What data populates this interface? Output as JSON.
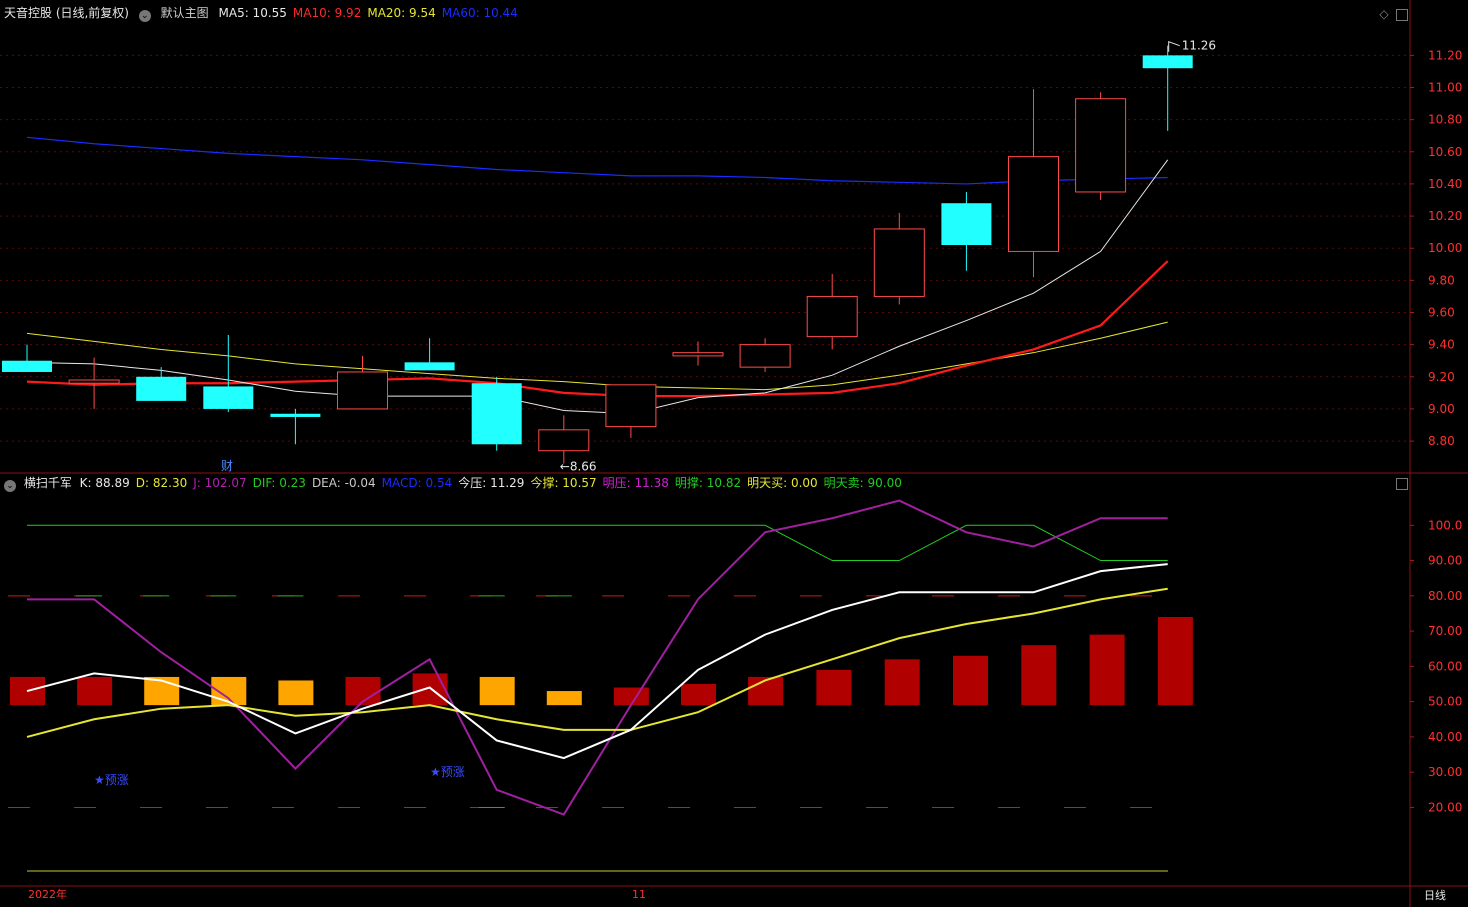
{
  "header": {
    "stock_name": "天音控股 (日线,前复权)",
    "main_chart_label": "默认主图",
    "ma": [
      {
        "label": "MA5: ",
        "value": "10.55",
        "color": "#e8e8e8"
      },
      {
        "label": "MA10: ",
        "value": "9.92",
        "color": "#ff2a2a"
      },
      {
        "label": "MA20: ",
        "value": "9.54",
        "color": "#e6e632"
      },
      {
        "label": "MA60: ",
        "value": "10.44",
        "color": "#1a2cff"
      }
    ]
  },
  "indicator_header": {
    "name": "横扫千军",
    "items": [
      {
        "text": "K: 88.89",
        "color": "#e8e8e8"
      },
      {
        "text": "D: 82.30",
        "color": "#e6e632"
      },
      {
        "text": "J: 102.07",
        "color": "#b020b0"
      },
      {
        "text": "DIF: 0.23",
        "color": "#22cc22"
      },
      {
        "text": "DEA: -0.04",
        "color": "#c8c8c8"
      },
      {
        "text": "MACD: 0.54",
        "color": "#1a2cff"
      },
      {
        "text": "今压: 11.29",
        "color": "#e8e8e8"
      },
      {
        "text": "今撑: 10.57",
        "color": "#e6e632"
      },
      {
        "text": "明压: 11.38",
        "color": "#d020d0"
      },
      {
        "text": "明撑: 10.82",
        "color": "#22cc22"
      },
      {
        "text": "明天买: 0.00",
        "color": "#e6e632"
      },
      {
        "text": "明天卖: 90.00",
        "color": "#22cc22"
      }
    ]
  },
  "bottom_bar": {
    "year_label": "2022年",
    "month_label": "11",
    "period_label": "日线"
  },
  "markers": {
    "finance": "财",
    "forecast": "★预涨"
  },
  "chart_data": [
    {
      "type": "candlestick",
      "ylim": [
        8.62,
        11.42
      ],
      "y_ticks": [
        "8.80",
        "9.00",
        "9.20",
        "9.40",
        "9.60",
        "9.80",
        "10.00",
        "10.20",
        "10.40",
        "10.60",
        "10.80",
        "11.00",
        "11.20"
      ],
      "y_tick_values": [
        8.8,
        9.0,
        9.2,
        9.4,
        9.6,
        9.8,
        10.0,
        10.2,
        10.4,
        10.6,
        10.8,
        11.0,
        11.2
      ],
      "candles": [
        {
          "o": 9.3,
          "h": 9.4,
          "l": 9.23,
          "c": 9.23
        },
        {
          "o": 9.16,
          "h": 9.32,
          "l": 9.0,
          "c": 9.18
        },
        {
          "o": 9.2,
          "h": 9.26,
          "l": 9.05,
          "c": 9.05
        },
        {
          "o": 9.14,
          "h": 9.46,
          "l": 8.98,
          "c": 9.0
        },
        {
          "o": 8.97,
          "h": 9.0,
          "l": 8.78,
          "c": 8.95
        },
        {
          "o": 9.0,
          "h": 9.33,
          "l": 9.0,
          "c": 9.23
        },
        {
          "o": 9.29,
          "h": 9.44,
          "l": 9.24,
          "c": 9.24
        },
        {
          "o": 9.16,
          "h": 9.2,
          "l": 8.74,
          "c": 8.78
        },
        {
          "o": 8.74,
          "h": 8.96,
          "l": 8.66,
          "c": 8.87
        },
        {
          "o": 8.89,
          "h": 9.15,
          "l": 8.82,
          "c": 9.15
        },
        {
          "o": 9.33,
          "h": 9.42,
          "l": 9.27,
          "c": 9.35
        },
        {
          "o": 9.26,
          "h": 9.44,
          "l": 9.23,
          "c": 9.4
        },
        {
          "o": 9.45,
          "h": 9.84,
          "l": 9.37,
          "c": 9.7
        },
        {
          "o": 9.7,
          "h": 10.22,
          "l": 9.65,
          "c": 10.12
        },
        {
          "o": 10.28,
          "h": 10.35,
          "l": 9.86,
          "c": 10.02
        },
        {
          "o": 9.98,
          "h": 10.99,
          "l": 9.82,
          "c": 10.57
        },
        {
          "o": 10.35,
          "h": 10.97,
          "l": 10.3,
          "c": 10.93
        },
        {
          "o": 11.2,
          "h": 11.26,
          "l": 10.73,
          "c": 11.12
        }
      ],
      "ma5": [
        9.29,
        9.28,
        9.24,
        9.18,
        9.11,
        9.08,
        9.08,
        9.08,
        8.99,
        8.97,
        9.07,
        9.1,
        9.21,
        9.39,
        9.55,
        9.72,
        9.98,
        10.55
      ],
      "ma10": [
        9.17,
        9.15,
        9.16,
        9.16,
        9.17,
        9.18,
        9.19,
        9.16,
        9.1,
        9.08,
        9.08,
        9.09,
        9.1,
        9.16,
        9.27,
        9.37,
        9.52,
        9.92
      ],
      "ma20": [
        9.47,
        9.42,
        9.37,
        9.33,
        9.28,
        9.25,
        9.22,
        9.19,
        9.17,
        9.14,
        9.13,
        9.12,
        9.15,
        9.21,
        9.28,
        9.35,
        9.44,
        9.54
      ],
      "ma60": [
        10.69,
        10.65,
        10.62,
        10.59,
        10.57,
        10.55,
        10.52,
        10.49,
        10.47,
        10.45,
        10.45,
        10.44,
        10.42,
        10.41,
        10.4,
        10.42,
        10.43,
        10.44
      ],
      "annotations": {
        "low": "←8.66",
        "high": "11.26"
      }
    },
    {
      "type": "line",
      "name": "横扫千军",
      "ylim": [
        0,
        110
      ],
      "y_ticks": [
        "20.00",
        "30.00",
        "40.00",
        "50.00",
        "60.00",
        "70.00",
        "80.00",
        "90.00",
        "100.0"
      ],
      "y_tick_values": [
        20,
        30,
        40,
        50,
        60,
        70,
        80,
        90,
        100
      ],
      "k": [
        53,
        58,
        56,
        50,
        41,
        48,
        54,
        39,
        34,
        42,
        59,
        69,
        76,
        81,
        81,
        81,
        87,
        89
      ],
      "d": [
        40,
        45,
        48,
        49,
        46,
        47,
        49,
        45,
        42,
        42,
        47,
        56,
        62,
        68,
        72,
        75,
        79,
        82
      ],
      "j": [
        79,
        79,
        64,
        51,
        31,
        50,
        62,
        25,
        18,
        49,
        79,
        98,
        102,
        107,
        98,
        94,
        102,
        102
      ],
      "bars": [
        {
          "v": 57,
          "c": "red"
        },
        {
          "v": 57,
          "c": "red"
        },
        {
          "v": 57,
          "c": "orange"
        },
        {
          "v": 57,
          "c": "orange"
        },
        {
          "v": 56,
          "c": "orange"
        },
        {
          "v": 57,
          "c": "red"
        },
        {
          "v": 58,
          "c": "red"
        },
        {
          "v": 57,
          "c": "orange"
        },
        {
          "v": 53,
          "c": "orange"
        },
        {
          "v": 54,
          "c": "red"
        },
        {
          "v": 55,
          "c": "red"
        },
        {
          "v": 57,
          "c": "red"
        },
        {
          "v": 59,
          "c": "red"
        },
        {
          "v": 62,
          "c": "red"
        },
        {
          "v": 63,
          "c": "red"
        },
        {
          "v": 66,
          "c": "red"
        },
        {
          "v": 69,
          "c": "red"
        },
        {
          "v": 74,
          "c": "red"
        }
      ],
      "bar_base": 49,
      "green_line": [
        100,
        100,
        100,
        100,
        100,
        100,
        100,
        100,
        100,
        100,
        100,
        100,
        90,
        90,
        100,
        100,
        90,
        90
      ],
      "ref_lines": {
        "red_dash": [
          80,
          20
        ],
        "yellow_solid": 2
      }
    }
  ]
}
